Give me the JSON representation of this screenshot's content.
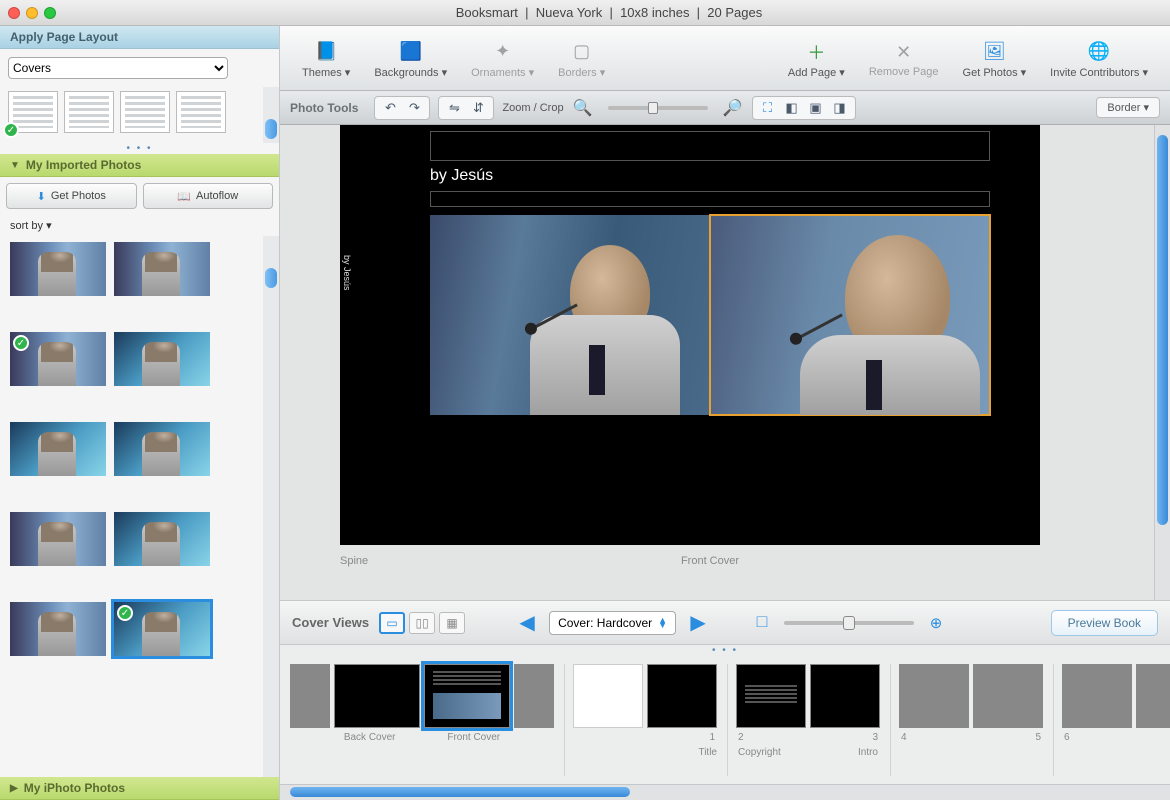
{
  "titlebar": {
    "app": "Booksmart",
    "project": "Nueva York",
    "size": "10x8 inches",
    "pages": "20 Pages"
  },
  "mainToolbar": {
    "themes": "Themes ▾",
    "backgrounds": "Backgrounds ▾",
    "ornaments": "Ornaments ▾",
    "borders": "Borders ▾",
    "addPage": "Add Page ▾",
    "removePage": "Remove Page",
    "getPhotos": "Get Photos ▾",
    "invite": "Invite Contributors ▾"
  },
  "subToolbar": {
    "label": "Photo Tools",
    "zoomCrop": "Zoom / Crop",
    "border": "Border ▾"
  },
  "leftPanel": {
    "applyLayout": "Apply Page Layout",
    "layoutSelect": "Covers",
    "importedPhotos": "My Imported Photos",
    "getPhotos": "Get Photos",
    "autoflow": "Autoflow",
    "sortBy": "sort by ▾",
    "iphoto": "My iPhoto Photos"
  },
  "canvas": {
    "byline": "by Jesús",
    "spineText": "by Jesús",
    "spineLabel": "Spine",
    "frontLabel": "Front Cover"
  },
  "bottomBar": {
    "coverViews": "Cover Views",
    "coverSelect": "Cover: Hardcover",
    "previewBook": "Preview Book",
    "pageLabels": {
      "back": "Back Cover",
      "front": "Front Cover",
      "title": "Title",
      "copyright": "Copyright",
      "intro": "Intro"
    },
    "pageNums": {
      "p1": "1",
      "p2": "2",
      "p3": "3",
      "p4": "4",
      "p5": "5",
      "p6": "6"
    }
  }
}
